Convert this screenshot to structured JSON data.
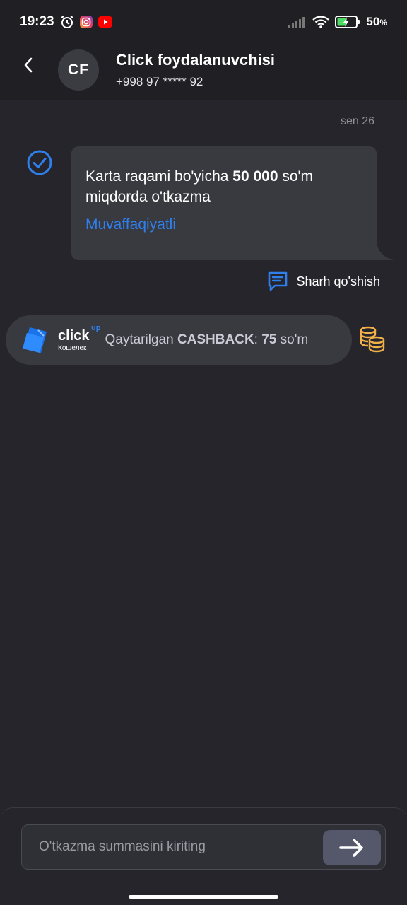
{
  "status_bar": {
    "time": "19:23",
    "battery": "50",
    "battery_unit": "%"
  },
  "header": {
    "avatar_initials": "CF",
    "contact_name": "Click foydalanuvchisi",
    "contact_phone": "+998 97 ***** 92"
  },
  "chat": {
    "date": "sen 26",
    "message": {
      "text_part1": "Karta raqami bo'yicha ",
      "amount": "50 000",
      "text_part2": " so'm miqdorda o'tkazma",
      "status": "Muvaffaqiyatli"
    },
    "comment_label": "Sharh qo'shish"
  },
  "cashback": {
    "brand": "click",
    "brand_sup": "up",
    "brand_sub": "Кошелек",
    "label": "Qaytarilgan ",
    "label_bold": "CASHBACK",
    "colon": ": ",
    "amount": "75",
    "currency": " so'm"
  },
  "input": {
    "placeholder": "O'tkazma summasini kiriting"
  },
  "colors": {
    "background": "#25252b",
    "bubble": "#393940",
    "accent_blue": "#2f80ed",
    "coins": "#f2b04a"
  }
}
